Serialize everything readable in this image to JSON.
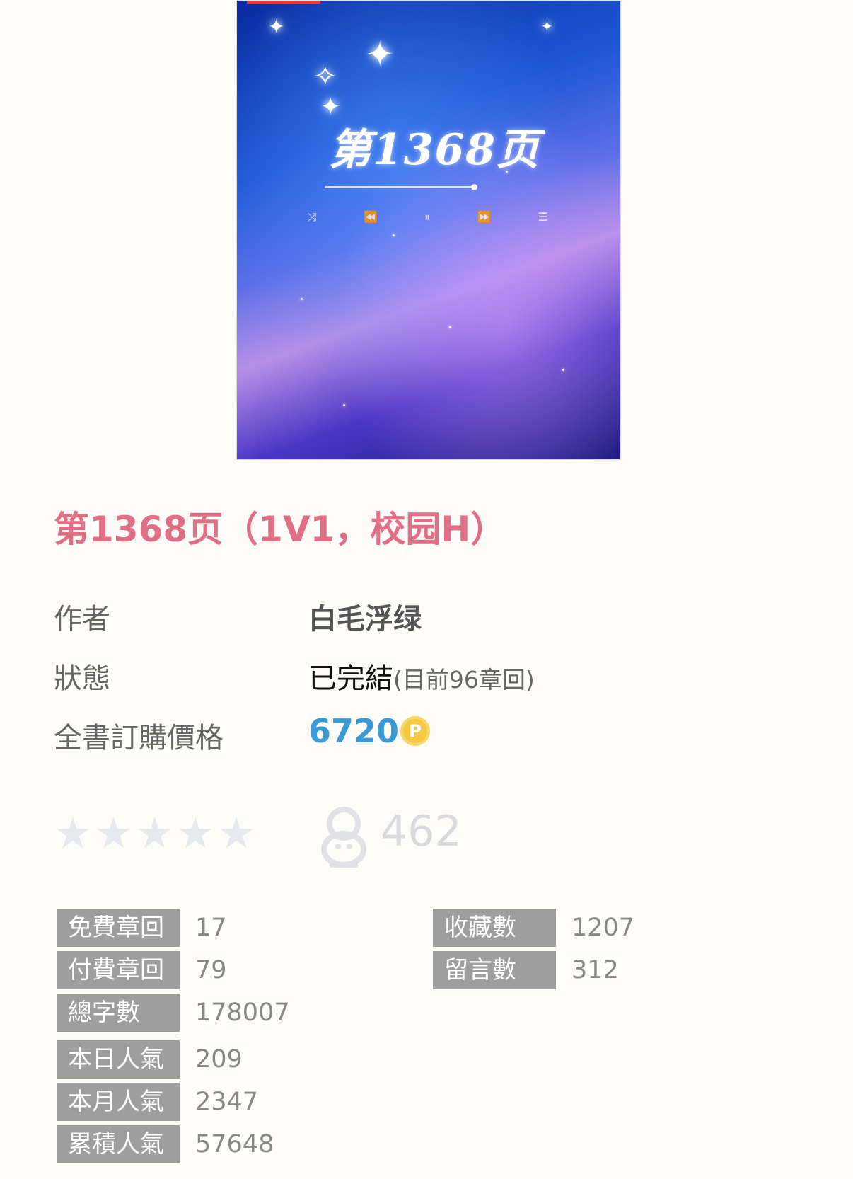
{
  "cover": {
    "title": "第1368页"
  },
  "book": {
    "title": "第1368页（1V1，校园H）"
  },
  "info": {
    "author_label": "作者",
    "author_value": "白毛浮绿",
    "status_label": "狀態",
    "status_value": "已完結",
    "status_detail": "(目前96章回)",
    "price_label": "全書訂購價格",
    "price_value": "6720",
    "coin_symbol": "P"
  },
  "rating": {
    "stars": 0,
    "max_stars": 5,
    "fan_count": "462"
  },
  "stats_left": [
    {
      "label": "免費章回",
      "value": "17"
    },
    {
      "label": "付費章回",
      "value": "79"
    },
    {
      "label": "總字數",
      "value": "178007"
    },
    {
      "label": "本日人氣",
      "value": "209"
    },
    {
      "label": "本月人氣",
      "value": "2347"
    },
    {
      "label": "累積人氣",
      "value": "57648"
    }
  ],
  "stats_right": [
    {
      "label": "收藏數",
      "value": "1207"
    },
    {
      "label": "留言數",
      "value": "312"
    }
  ],
  "colors": {
    "title": "#e06f86",
    "price": "#3a9ad6",
    "label_bg": "#9e9e9e"
  },
  "icons": {
    "coin": "coin-icon",
    "star": "star-icon",
    "fan": "fan-icon"
  }
}
